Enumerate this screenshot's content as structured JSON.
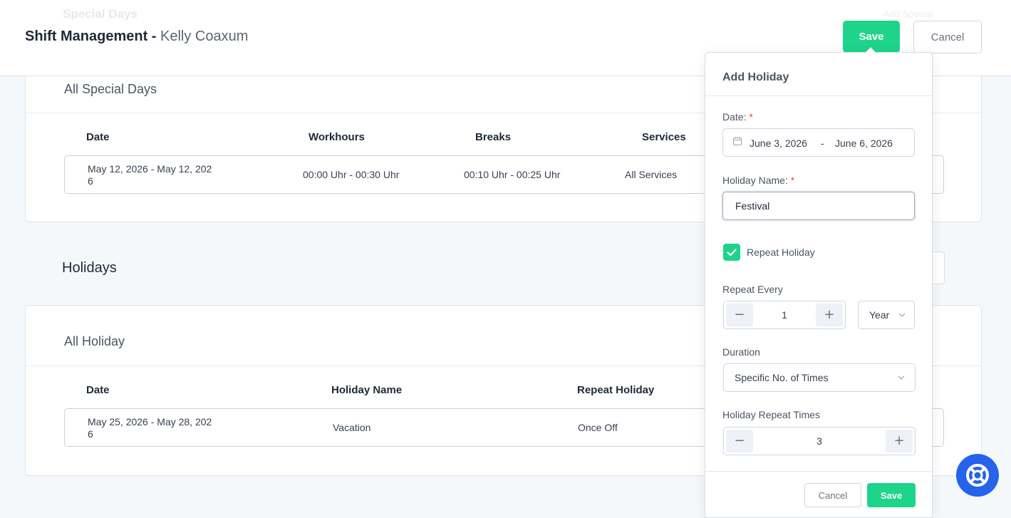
{
  "header": {
    "ghost_title": "Special Days",
    "ghost_right": "Add Special",
    "title": "Shift Management - ",
    "user_name": "Kelly Coaxum",
    "save_label": "Save",
    "cancel_label": "Cancel"
  },
  "special_days": {
    "title": "All Special Days",
    "columns": [
      "Date",
      "Workhours",
      "Breaks",
      "Services"
    ],
    "rows": [
      {
        "date": "May 12, 2026 - May 12, 2026",
        "workhours": "00:00 Uhr - 00:30 Uhr",
        "breaks": "00:10 Uhr - 00:25 Uhr",
        "services": "All Services"
      }
    ]
  },
  "holidays": {
    "section_title": "Holidays",
    "title": "All Holiday",
    "columns": [
      "Date",
      "Holiday Name",
      "Repeat Holiday"
    ],
    "rows": [
      {
        "date": "May 25, 2026 - May 28, 2026",
        "name": "Vacation",
        "repeat": "Once Off"
      }
    ]
  },
  "add_holiday": {
    "title": "Add Holiday",
    "date_label": "Date:",
    "required_mark": "*",
    "date_start": "June 3, 2026",
    "date_sep": "-",
    "date_end": "June 6, 2026",
    "name_label": "Holiday Name:",
    "name_value": "Festival",
    "repeat_label": "Repeat Holiday",
    "repeat_checked": true,
    "repeat_every_label": "Repeat Every",
    "repeat_every_value": "1",
    "repeat_unit": "Year",
    "duration_label": "Duration",
    "duration_value": "Specific No. of Times",
    "repeat_times_label": "Holiday Repeat Times",
    "repeat_times_value": "3",
    "minus_symbol": "−",
    "plus_symbol": "+",
    "cancel_label": "Cancel",
    "save_label": "Save"
  },
  "colors": {
    "accent": "#1ed48a",
    "help_button": "#2563eb"
  },
  "icons": {
    "calendar": "calendar-icon",
    "check": "check-icon",
    "chevron": "chevron-down-icon",
    "help": "lifebuoy-icon"
  }
}
